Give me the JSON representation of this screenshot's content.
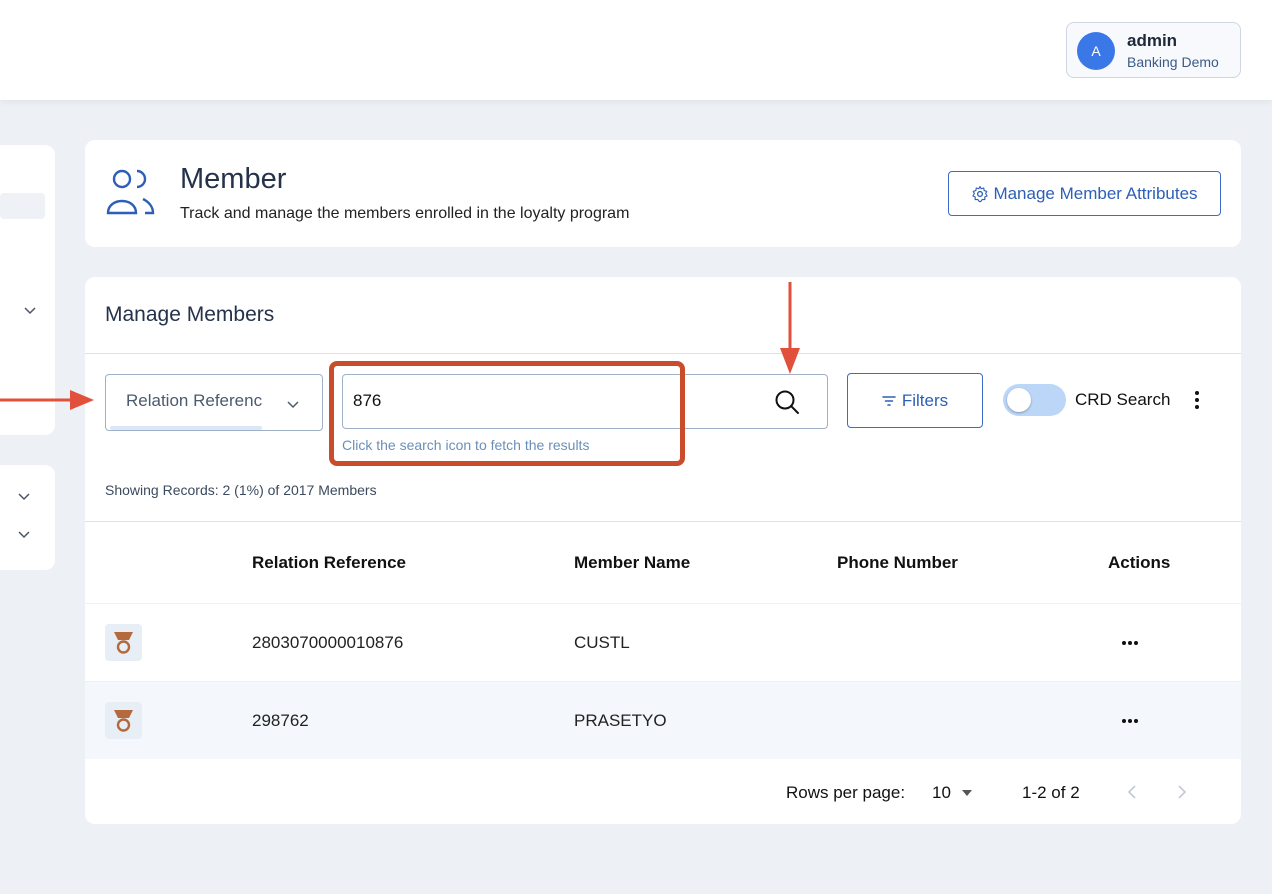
{
  "header": {
    "user": {
      "avatar_initial": "A",
      "name": "admin",
      "org": "Banking Demo"
    }
  },
  "page": {
    "title": "Member",
    "subtitle": "Track and manage the members enrolled in the loyalty program",
    "manage_attributes_label": "Manage Member Attributes",
    "icon": "members-icon"
  },
  "manage": {
    "section_title": "Manage Members",
    "search_by": {
      "selected": "Relation Referenc"
    },
    "search": {
      "value": "876",
      "hint": "Click the search icon to fetch the results"
    },
    "filters_label": "Filters",
    "crd_toggle": {
      "label": "CRD Search",
      "on": false
    },
    "records_text": "Showing Records: 2 (1%) of 2017 Members"
  },
  "table": {
    "columns": [
      "Relation Reference",
      "Member Name",
      "Phone Number",
      "Actions"
    ],
    "rows": [
      {
        "relation_reference": "2803070000010876",
        "member_name": "CUSTL",
        "phone_number": "",
        "actions": "..."
      },
      {
        "relation_reference": "298762",
        "member_name": "PRASETYO",
        "phone_number": "",
        "actions": "..."
      }
    ]
  },
  "pagination": {
    "rows_per_page_label": "Rows per page:",
    "rows_per_page": "10",
    "range": "1-2 of 2"
  },
  "colors": {
    "accent": "#2d5fb8",
    "annotation_red": "#c94d2b",
    "annotation_arrow": "#e0503a",
    "avatar": "#3b78e7",
    "toggle_track": "#bcd6f7"
  }
}
